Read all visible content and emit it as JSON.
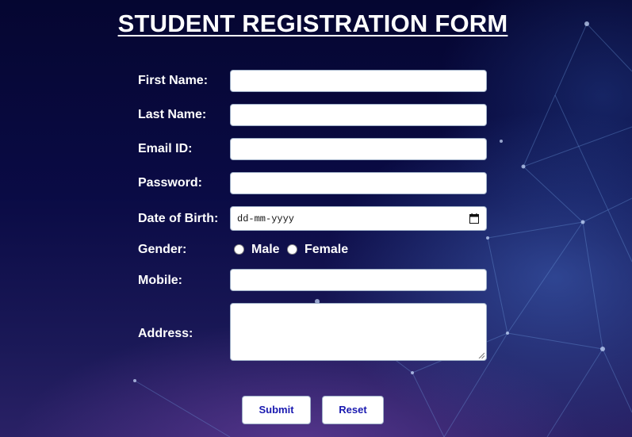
{
  "form": {
    "title": "STUDENT REGISTRATION FORM",
    "fields": {
      "first_name": {
        "label": "First Name:",
        "value": ""
      },
      "last_name": {
        "label": "Last Name:",
        "value": ""
      },
      "email": {
        "label": "Email ID:",
        "value": ""
      },
      "password": {
        "label": "Password:",
        "value": ""
      },
      "dob": {
        "label": "Date of Birth:",
        "placeholder": "dd-mm-yyyy",
        "icon": "calendar-icon"
      },
      "gender": {
        "label": "Gender:",
        "options": [
          "Male",
          "Female"
        ],
        "selected": ""
      },
      "mobile": {
        "label": "Mobile:",
        "value": ""
      },
      "address": {
        "label": "Address:",
        "value": ""
      }
    },
    "buttons": {
      "submit": "Submit",
      "reset": "Reset"
    }
  },
  "colors": {
    "background_dark": "#050631",
    "background_purple": "#2a2166",
    "button_text": "#1a1ab0",
    "label_text": "#ffffff"
  }
}
